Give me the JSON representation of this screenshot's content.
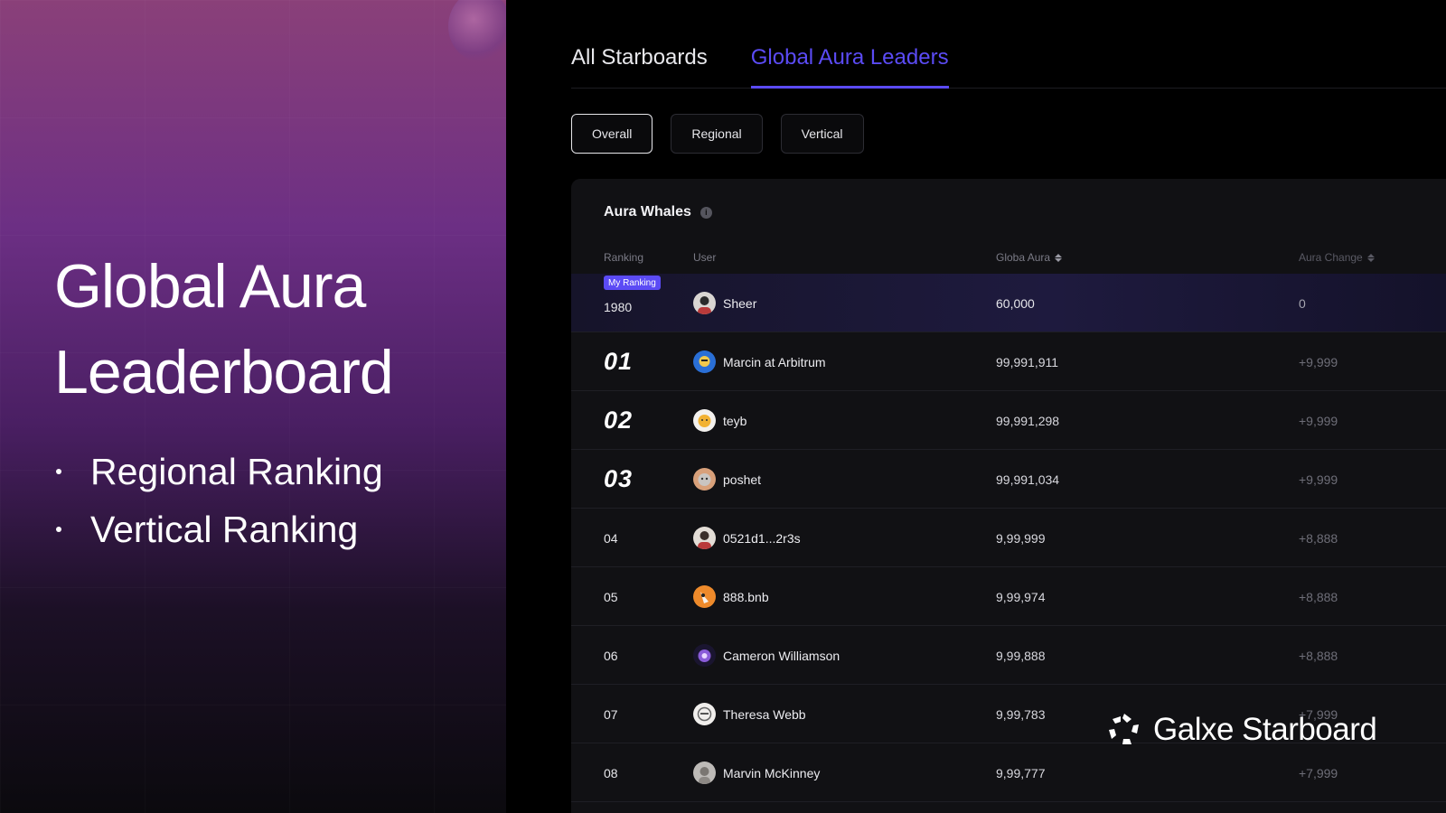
{
  "hero": {
    "title": "Global Aura Leaderboard",
    "bullets": [
      "Regional Ranking",
      "Vertical Ranking"
    ]
  },
  "tabs": [
    {
      "label": "All Starboards",
      "active": false
    },
    {
      "label": "Global Aura Leaders",
      "active": true
    }
  ],
  "filters": [
    {
      "label": "Overall",
      "active": true
    },
    {
      "label": "Regional",
      "active": false
    },
    {
      "label": "Vertical",
      "active": false
    }
  ],
  "board": {
    "title": "Aura Whales",
    "info_icon": "info-icon",
    "columns": {
      "ranking": "Ranking",
      "user": "User",
      "aura": "Globa Aura",
      "change": "Aura Change"
    },
    "my_ranking_badge": "My Ranking",
    "my_row": {
      "rank": "1980",
      "user": "Sheer",
      "aura": "60,000",
      "change": "0"
    },
    "rows": [
      {
        "rank": "01",
        "user": "Marcin at Arbitrum",
        "aura": "99,991,911",
        "change": "+9,999"
      },
      {
        "rank": "02",
        "user": "teyb",
        "aura": "99,991,298",
        "change": "+9,999"
      },
      {
        "rank": "03",
        "user": "poshet",
        "aura": "99,991,034",
        "change": "+9,999"
      },
      {
        "rank": "04",
        "user": "0521d1...2r3s",
        "aura": "9,99,999",
        "change": "+8,888"
      },
      {
        "rank": "05",
        "user": "888.bnb",
        "aura": "9,99,974",
        "change": "+8,888"
      },
      {
        "rank": "06",
        "user": "Cameron Williamson",
        "aura": "9,99,888",
        "change": "+8,888"
      },
      {
        "rank": "07",
        "user": "Theresa Webb",
        "aura": "9,99,783",
        "change": "+7,999"
      },
      {
        "rank": "08",
        "user": "Marvin McKinney",
        "aura": "9,99,777",
        "change": "+7,999"
      }
    ]
  },
  "brand": {
    "name": "Galxe Starboard",
    "logo_icon": "galxe-logo-icon"
  },
  "colors": {
    "accent": "#5b4bf5",
    "panel": "#111114",
    "background": "#000000"
  }
}
